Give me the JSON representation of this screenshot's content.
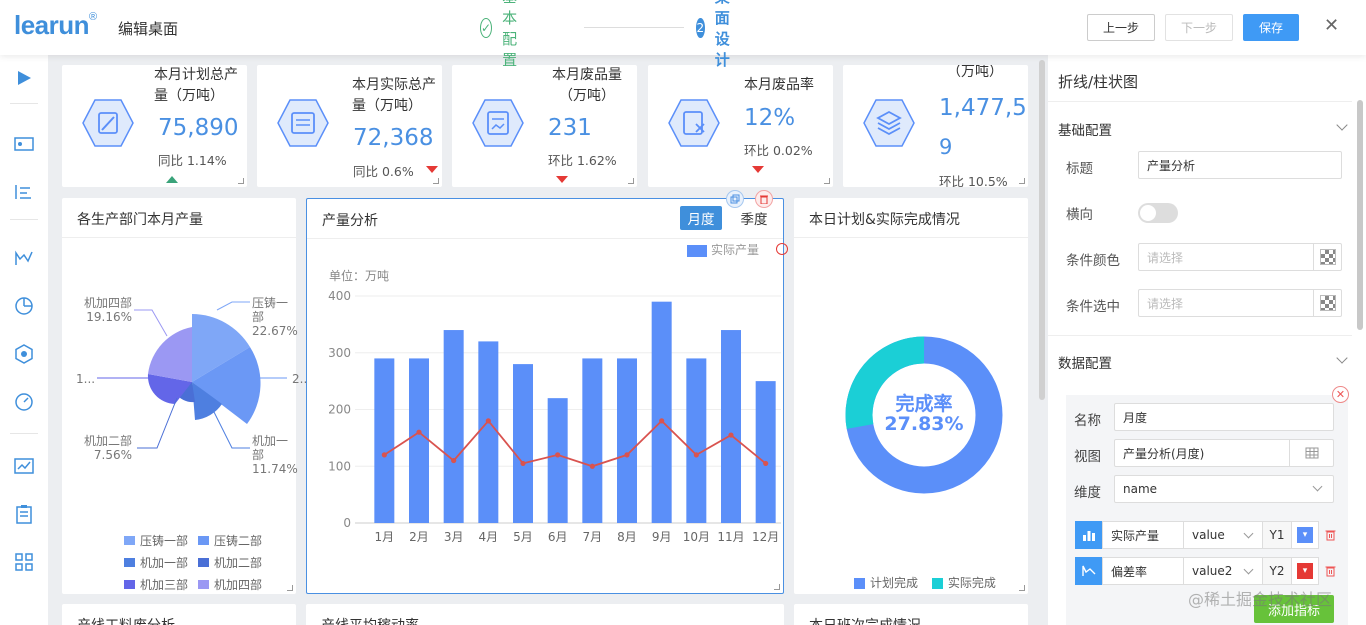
{
  "header": {
    "logo_text": "learun",
    "logo_mark": "®",
    "title": "编辑桌面",
    "step1": {
      "num": "✓",
      "label": "基本配置"
    },
    "step2": {
      "num": "2",
      "label": "桌面设计"
    },
    "prev_label": "上一步",
    "next_label": "下一步",
    "save_label": "保存",
    "close_label": "✕"
  },
  "colors": {
    "accent": "#3f8fdb",
    "bar": "#5b8ff9",
    "line": "#d9534f",
    "teal": "#1bcfd6",
    "green": "#67c23a",
    "up": "#3aa37a",
    "down": "#e53935"
  },
  "kpis": [
    {
      "title": "本月计划总产量（万吨）",
      "value": "75,890",
      "ratio": "同比 1.14%",
      "trend": "up",
      "icon": "wrench-icon"
    },
    {
      "title": "本月实际总产量（万吨）",
      "value": "72,368",
      "ratio": "同比 0.6%",
      "trend": "down",
      "icon": "calendar-icon"
    },
    {
      "title": "本月废品量（万吨）",
      "value": "231",
      "ratio": "环比 1.62%",
      "trend": "down",
      "icon": "report-icon"
    },
    {
      "title": "本月废品率",
      "value": "12%",
      "ratio": "环比 0.02%",
      "trend": "down",
      "icon": "doc-x-icon"
    },
    {
      "title": "（万吨）",
      "value": "1,477,58",
      "value2": "9",
      "ratio": "环比 10.5%",
      "trend": "down",
      "icon": "layers-icon"
    }
  ],
  "rose": {
    "title": "各生产部门本月产量",
    "labels": [
      {
        "name": "机加四部",
        "pct": "19.16%"
      },
      {
        "name": "压铸一部",
        "pct": "22.67%"
      },
      {
        "name": "1...",
        "pct": ""
      },
      {
        "name": "2...",
        "pct": ""
      },
      {
        "name": "机加二部",
        "pct": "7.56%"
      },
      {
        "name": "机加一部",
        "pct": "11.74%"
      }
    ],
    "legend": [
      "压铸一部",
      "压铸二部",
      "机加一部",
      "机加二部",
      "机加三部",
      "机加四部"
    ]
  },
  "main_chart": {
    "title": "产量分析",
    "tab_month": "月度",
    "tab_quarter": "季度",
    "legend": "实际产量",
    "unit": "单位：万吨"
  },
  "chart_data": {
    "type": "bar",
    "categories": [
      "1月",
      "2月",
      "3月",
      "4月",
      "5月",
      "6月",
      "7月",
      "8月",
      "9月",
      "10月",
      "11月",
      "12月"
    ],
    "series": [
      {
        "name": "实际产量",
        "type": "bar",
        "values": [
          290,
          290,
          340,
          320,
          280,
          220,
          290,
          290,
          390,
          290,
          340,
          250
        ]
      },
      {
        "type": "line",
        "values": [
          120,
          160,
          110,
          180,
          105,
          120,
          100,
          120,
          180,
          120,
          155,
          105
        ]
      }
    ],
    "yticks": [
      0,
      100,
      200,
      300,
      400
    ],
    "ylim": [
      0,
      400
    ]
  },
  "donut": {
    "title": "本日计划&实际完成情况",
    "center_label": "完成率",
    "center_value": "27.83%",
    "legend_plan": "计划完成",
    "legend_actual": "实际完成",
    "actual_pct": 27.83
  },
  "bottom_titles": [
    "产线工料废分析",
    "产线平均稼动率",
    "本日班次完成情况"
  ],
  "right_panel": {
    "title": "折线/柱状图",
    "basic_section": "基础配置",
    "label_title": "标题",
    "title_value": "产量分析",
    "label_horizontal": "横向",
    "label_cond_color": "条件颜色",
    "cond_color_placeholder": "请选择",
    "label_cond_select": "条件选中",
    "cond_select_placeholder": "请选择",
    "data_section": "数据配置",
    "label_name": "名称",
    "name_value": "月度",
    "label_view": "视图",
    "view_value": "产量分析(月度)",
    "label_dim": "维度",
    "dim_value": "name",
    "metrics": [
      {
        "name": "实际产量",
        "field": "value",
        "axis": "Y1",
        "color": "#5b8ff9",
        "icon": "bar-chart-icon"
      },
      {
        "name": "偏差率",
        "field": "value2",
        "axis": "Y2",
        "color": "#e53935",
        "icon": "line-chart-icon"
      }
    ],
    "add_label": "添加指标",
    "watermark": "@稀土掘金技术社区"
  }
}
